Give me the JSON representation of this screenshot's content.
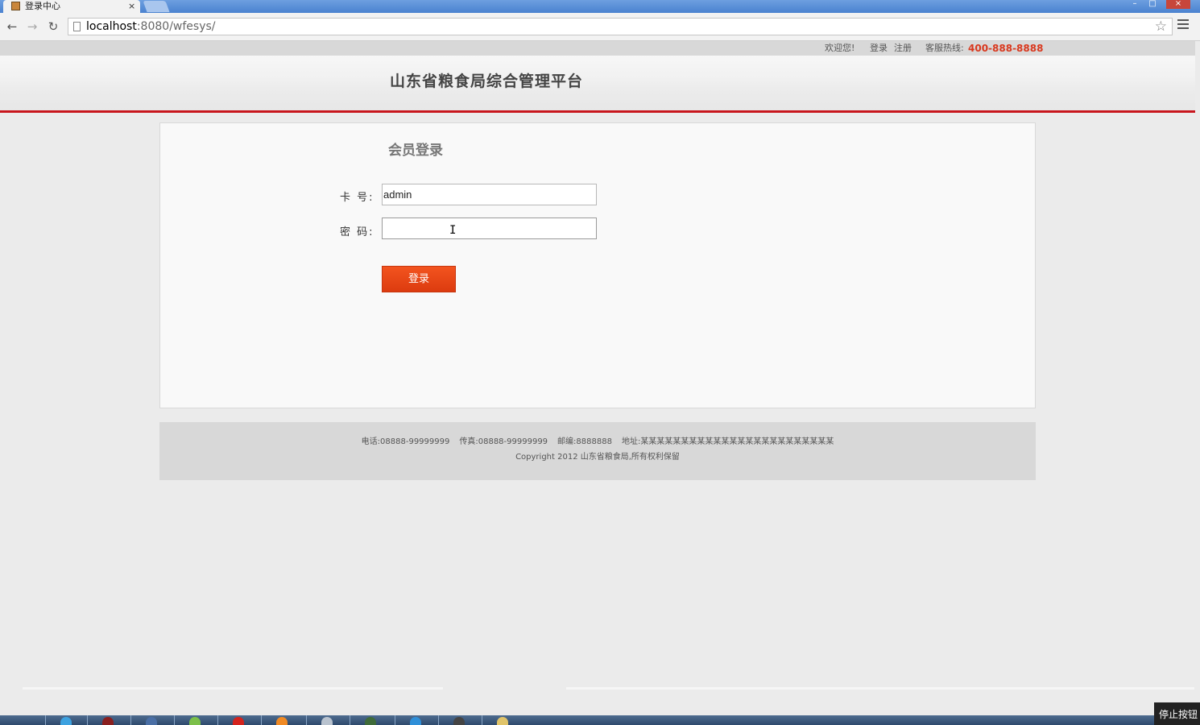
{
  "browser": {
    "tab_title": "登录中心",
    "tab_close": "×",
    "url_host": "localhost",
    "url_rest": ":8080/wfesys/",
    "window_controls": {
      "minimize": "–",
      "maximize": "□",
      "close": "×"
    },
    "nav": {
      "back": "←",
      "forward": "→",
      "reload": "↻",
      "bookmark": "☆"
    }
  },
  "topbar": {
    "welcome": "欢迎您!",
    "login": "登录",
    "register": "注册",
    "hotline_label": "客服热线:",
    "hotline": "400-888-8888"
  },
  "header": {
    "site_title": "山东省粮食局综合管理平台"
  },
  "login_form": {
    "title": "会员登录",
    "card_label": "卡 号:",
    "card_value": "admin",
    "password_label": "密 码:",
    "password_value": "",
    "submit": "登录"
  },
  "footer": {
    "phone": "电话:08888-99999999",
    "fax": "传真:08888-99999999",
    "zip": "邮编:8888888",
    "address": "地址:某某某某某某某某某某某某某某某某某某某某某某某某",
    "copyright": "Copyright 2012 山东省粮食局,所有权利保留"
  },
  "overlay": {
    "stop_button": "停止按钮"
  },
  "colors": {
    "accent_red": "#c8161d",
    "button_orange": "#e8451a",
    "hotline_red": "#d9381e"
  }
}
